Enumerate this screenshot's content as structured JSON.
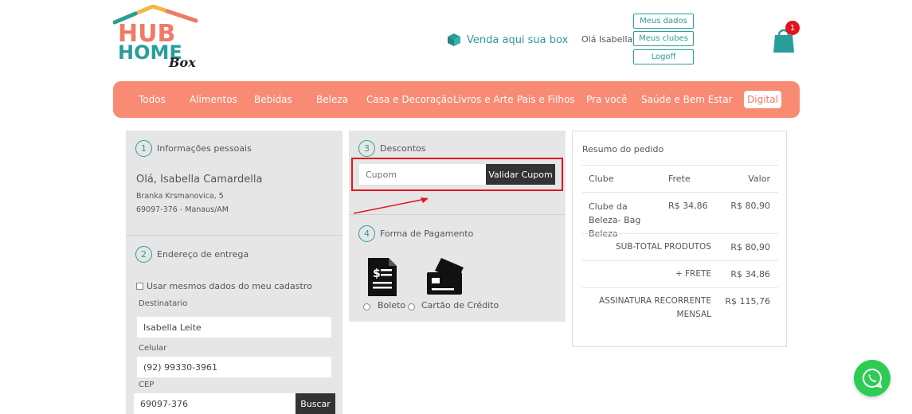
{
  "header": {
    "logo_text_hub": "HUB",
    "logo_text_home": "HOME",
    "logo_text_box": "Box",
    "sell_link": "Venda aqui sua box",
    "greeting": "Olá Isabella",
    "buttons": [
      "Meus dados",
      "Meus clubes",
      "Logoff"
    ],
    "cart_count": "1"
  },
  "nav": {
    "items": [
      "Todos",
      "Alimentos",
      "Bebidas",
      "Beleza",
      "Casa e Decoração",
      "Livros e Arte",
      "Pais e Filhos",
      "Pra você",
      "Saúde e Bem Estar",
      "Digital"
    ]
  },
  "personal": {
    "step": "1",
    "title": "Informações pessoais",
    "name": "Olá, Isabella Camardella",
    "address": "Branka Krsmanovica, 5",
    "zip_city": "69097-376 - Manaus/AM"
  },
  "delivery": {
    "step": "2",
    "title": "Endereço de entrega",
    "same_data_label": "Usar mesmos dados do meu cadastro",
    "recipient_label": "Destinatario",
    "recipient_value": "Isabella Leite",
    "phone_label": "Celular",
    "phone_value": "(92) 99330-3961",
    "cep_label": "CEP",
    "cep_value": "69097-376",
    "search_button": "Buscar"
  },
  "discounts": {
    "step": "3",
    "title": "Descontos",
    "coupon_placeholder": "Cupom",
    "validate_button": "Validar Cupom"
  },
  "payment": {
    "step": "4",
    "title": "Forma de Pagamento",
    "option_boleto": "Boleto",
    "option_card": "Cartão de Crédito"
  },
  "summary": {
    "title": "Resumo do pedido",
    "col_club": "Clube",
    "col_shipping": "Frete",
    "col_value": "Valor",
    "row_club": "Clube da Beleza- Bag Beleza",
    "row_shipping": "R$ 34,86",
    "row_value": "R$ 80,90",
    "subtotal_label": "SUB-TOTAL PRODUTOS",
    "subtotal_value": "R$ 80,90",
    "freight_label": "+ FRETE",
    "freight_value": "R$ 34,86",
    "recurring_label_1": "ASSINATURA RECORRENTE",
    "recurring_label_2": "MENSAL",
    "recurring_value": "R$ 115,76"
  },
  "colors": {
    "nav_bg": "#f98a73",
    "accent_teal": "#2a9d9b",
    "highlight_red": "#e0171f",
    "whatsapp_green": "#2ecc55"
  }
}
